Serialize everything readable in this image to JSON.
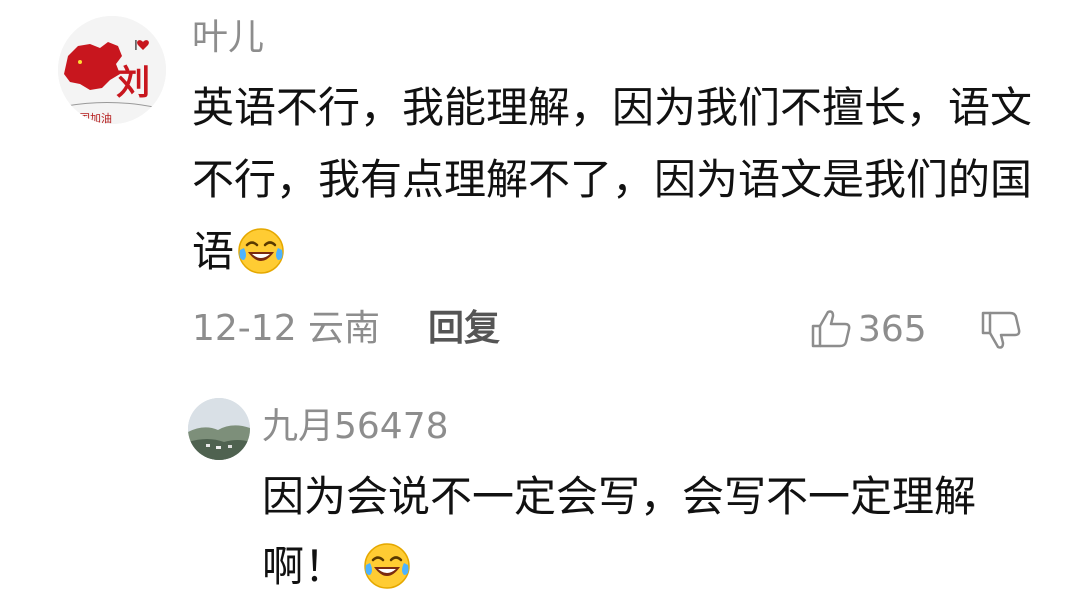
{
  "comment": {
    "username": "叶儿",
    "avatar_icon": "avatar-map-with-liu-character",
    "text": "英语不行，我能理解，因为我们不擅长，语文不行，我有点理解不了，因为语文是我们的国语",
    "emoji_icon": "laughing-tears-emoji",
    "date_location": "12-12 云南",
    "reply_label": "回复",
    "like_count": "365",
    "like_icon": "thumbs-up-icon",
    "dislike_icon": "thumbs-down-icon"
  },
  "reply": {
    "username": "九月56478",
    "avatar_icon": "avatar-landscape-photo",
    "text": "因为会说不一定会写，会写不一定理解啊！",
    "emoji_icon": "laughing-tears-emoji"
  },
  "colors": {
    "meta_gray": "#8d8d8d",
    "text_black": "#111111",
    "background": "#ffffff",
    "accent_red": "#c8161e"
  }
}
